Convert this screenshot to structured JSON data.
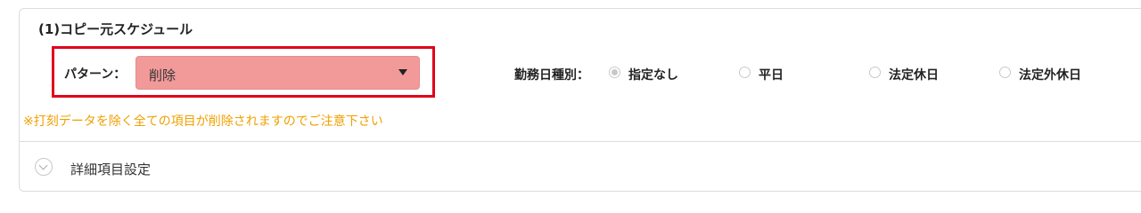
{
  "section": {
    "title": "(1)コピー元スケジュール"
  },
  "pattern": {
    "label": "パターン：",
    "selected_value": "削除",
    "highlight_color": "#e0001b",
    "select_color": "#f29a9a"
  },
  "day_type": {
    "label": "勤務日種別：",
    "options": [
      {
        "label": "指定なし",
        "checked": true
      },
      {
        "label": "平日",
        "checked": false
      },
      {
        "label": "法定休日",
        "checked": false
      },
      {
        "label": "法定外休日",
        "checked": false
      }
    ]
  },
  "warning": {
    "text": "※打刻データを除く全ての項目が削除されますのでご注意下さい",
    "color": "#f0a000"
  },
  "details": {
    "label": "詳細項目設定"
  }
}
